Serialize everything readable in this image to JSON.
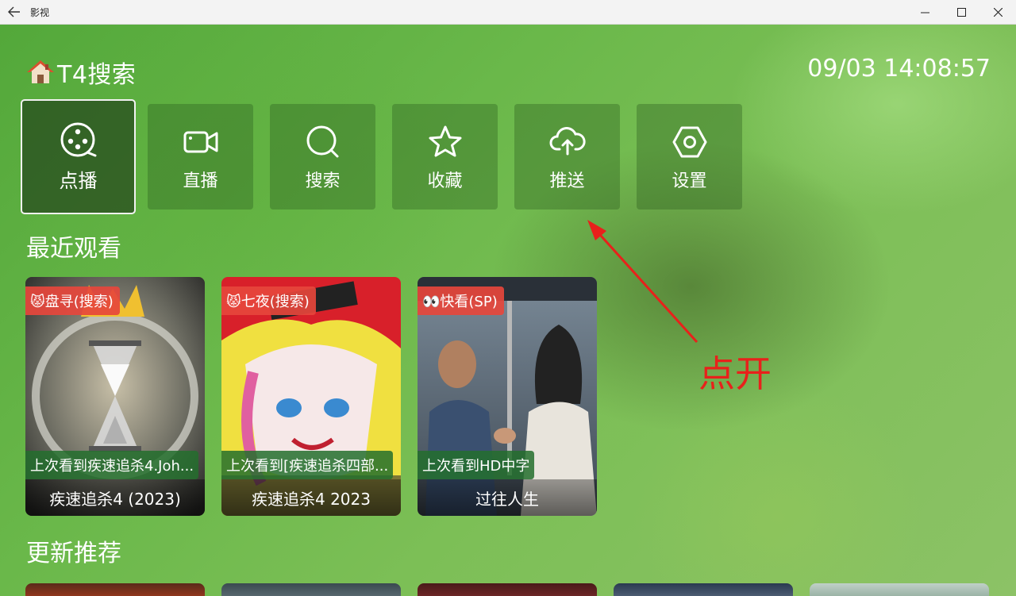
{
  "window": {
    "title": "影视"
  },
  "header": {
    "title": "T4搜索",
    "datetime": "09/03 14:08:57"
  },
  "nav": [
    {
      "label": "点播",
      "icon": "film-reel-icon",
      "active": true
    },
    {
      "label": "直播",
      "icon": "video-camera-icon"
    },
    {
      "label": "搜索",
      "icon": "search-icon"
    },
    {
      "label": "收藏",
      "icon": "star-icon"
    },
    {
      "label": "推送",
      "icon": "cloud-upload-icon"
    },
    {
      "label": "设置",
      "icon": "hexagon-gear-icon"
    }
  ],
  "recent": {
    "title": "最近观看",
    "items": [
      {
        "badge": "😾盘寻(搜索)",
        "progress": "上次看到疾速追杀4.Joh...",
        "name": "疾速追杀4 (2023)"
      },
      {
        "badge": "😾七夜(搜索)",
        "progress": "上次看到[疾速追杀四部...",
        "name": "疾速追杀4 2023"
      },
      {
        "badge": "👀快看(SP)",
        "progress": "上次看到HD中字",
        "name": "过往人生"
      }
    ]
  },
  "recommend": {
    "title": "更新推荐"
  },
  "annotation": {
    "text": "点开",
    "color": "#e8211b"
  }
}
